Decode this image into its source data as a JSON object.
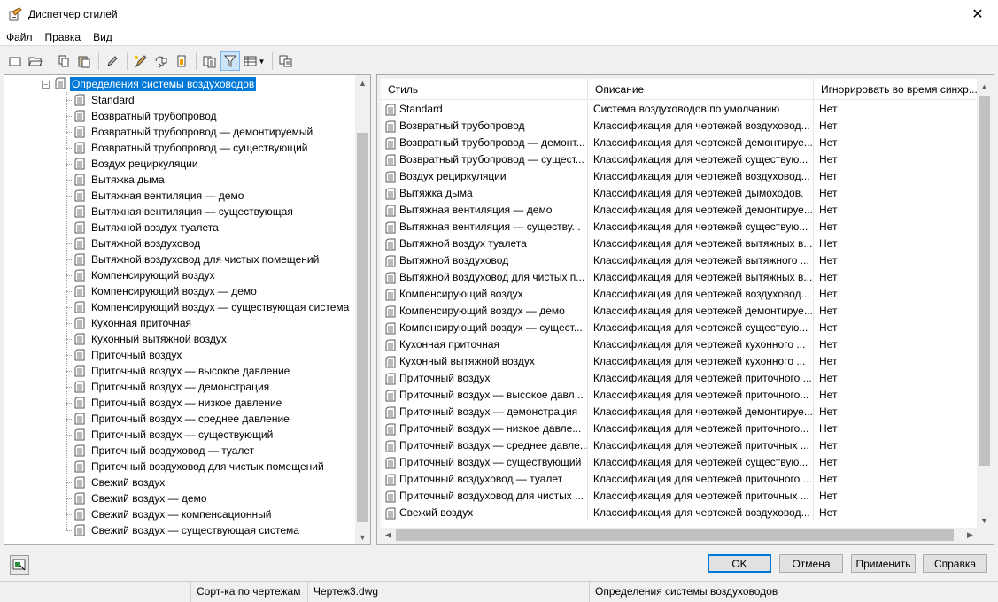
{
  "window": {
    "title": "Диспетчер стилей"
  },
  "menu": [
    {
      "label": "Файл",
      "name": "menu-file"
    },
    {
      "label": "Правка",
      "name": "menu-edit"
    },
    {
      "label": "Вид",
      "name": "menu-view"
    }
  ],
  "tree": {
    "root_label": "Определения системы воздуховодов",
    "items": [
      "Standard",
      "Возвратный трубопровод",
      "Возвратный трубопровод — демонтируемый",
      "Возвратный трубопровод — существующий",
      "Воздух рециркуляции",
      "Вытяжка дыма",
      "Вытяжная вентиляция — демо",
      "Вытяжная вентиляция — существующая",
      "Вытяжной воздух туалета",
      "Вытяжной воздуховод",
      "Вытяжной воздуховод для чистых помещений",
      "Компенсирующий воздух",
      "Компенсирующий воздух — демо",
      "Компенсирующий воздух — существующая система",
      "Кухонная приточная",
      "Кухонный вытяжной воздух",
      "Приточный воздух",
      "Приточный воздух — высокое давление",
      "Приточный воздух — демонстрация",
      "Приточный воздух — низкое давление",
      "Приточный воздух — среднее давление",
      "Приточный воздух — существующий",
      "Приточный воздуховод — туалет",
      "Приточный воздуховод для чистых помещений",
      "Свежий воздух",
      "Свежий воздух — демо",
      "Свежий воздух — компенсационный",
      "Свежий воздух — существующая система"
    ]
  },
  "list": {
    "columns": [
      "Стиль",
      "Описание",
      "Игнорировать во время синхр..."
    ],
    "rows": [
      [
        "Standard",
        "Система воздуховодов по умолчанию",
        "Нет"
      ],
      [
        "Возвратный трубопровод",
        "Классификация для чертежей воздуховод...",
        "Нет"
      ],
      [
        "Возвратный трубопровод — демонт...",
        "Классификация для чертежей демонтируе...",
        "Нет"
      ],
      [
        "Возвратный трубопровод — сущест...",
        "Классификация для чертежей существую...",
        "Нет"
      ],
      [
        "Воздух рециркуляции",
        "Классификация для чертежей воздуховод...",
        "Нет"
      ],
      [
        "Вытяжка дыма",
        "Классификация для чертежей дымоходов.",
        "Нет"
      ],
      [
        "Вытяжная вентиляция — демо",
        "Классификация для чертежей демонтируе...",
        "Нет"
      ],
      [
        "Вытяжная вентиляция — существу...",
        "Классификация для чертежей существую...",
        "Нет"
      ],
      [
        "Вытяжной воздух туалета",
        "Классификация для чертежей вытяжных в...",
        "Нет"
      ],
      [
        "Вытяжной воздуховод",
        "Классификация для чертежей вытяжного ...",
        "Нет"
      ],
      [
        "Вытяжной воздуховод для чистых п...",
        "Классификация для чертежей вытяжных в...",
        "Нет"
      ],
      [
        "Компенсирующий воздух",
        "Классификация для чертежей воздуховод...",
        "Нет"
      ],
      [
        "Компенсирующий воздух — демо",
        "Классификация для чертежей демонтируе...",
        "Нет"
      ],
      [
        "Компенсирующий воздух — сущест...",
        "Классификация для чертежей существую...",
        "Нет"
      ],
      [
        "Кухонная приточная",
        "Классификация для чертежей кухонного ...",
        "Нет"
      ],
      [
        "Кухонный вытяжной воздух",
        "Классификация для чертежей кухонного ...",
        "Нет"
      ],
      [
        "Приточный воздух",
        "Классификация для чертежей приточного ...",
        "Нет"
      ],
      [
        "Приточный воздух — высокое давл...",
        "Классификация для чертежей приточного...",
        "Нет"
      ],
      [
        "Приточный воздух — демонстрация",
        "Классификация для чертежей демонтируе...",
        "Нет"
      ],
      [
        "Приточный воздух — низкое давле...",
        "Классификация для чертежей приточного...",
        "Нет"
      ],
      [
        "Приточный воздух — среднее давле...",
        "Классификация для чертежей приточных ...",
        "Нет"
      ],
      [
        "Приточный воздух — существующий",
        "Классификация для чертежей существую...",
        "Нет"
      ],
      [
        "Приточный воздуховод — туалет",
        "Классификация для чертежей приточного ...",
        "Нет"
      ],
      [
        "Приточный воздуховод для чистых ...",
        "Классификация для чертежей приточных ...",
        "Нет"
      ],
      [
        "Свежий воздух",
        "Классификация для чертежей воздуховод...",
        "Нет"
      ]
    ]
  },
  "buttons": {
    "ok": "OK",
    "cancel": "Отмена",
    "apply": "Применить",
    "help": "Справка"
  },
  "status": {
    "sort": "Сорт-ка по чертежам",
    "drawing": "Чертеж3.dwg",
    "category": "Определения системы воздуховодов"
  },
  "icons": {
    "app": "style-manager-icon",
    "style_item": "duct-system-style-icon",
    "filter_active": true
  },
  "colors": {
    "selection": "#0078d7",
    "accent_border": "#0078d7"
  }
}
